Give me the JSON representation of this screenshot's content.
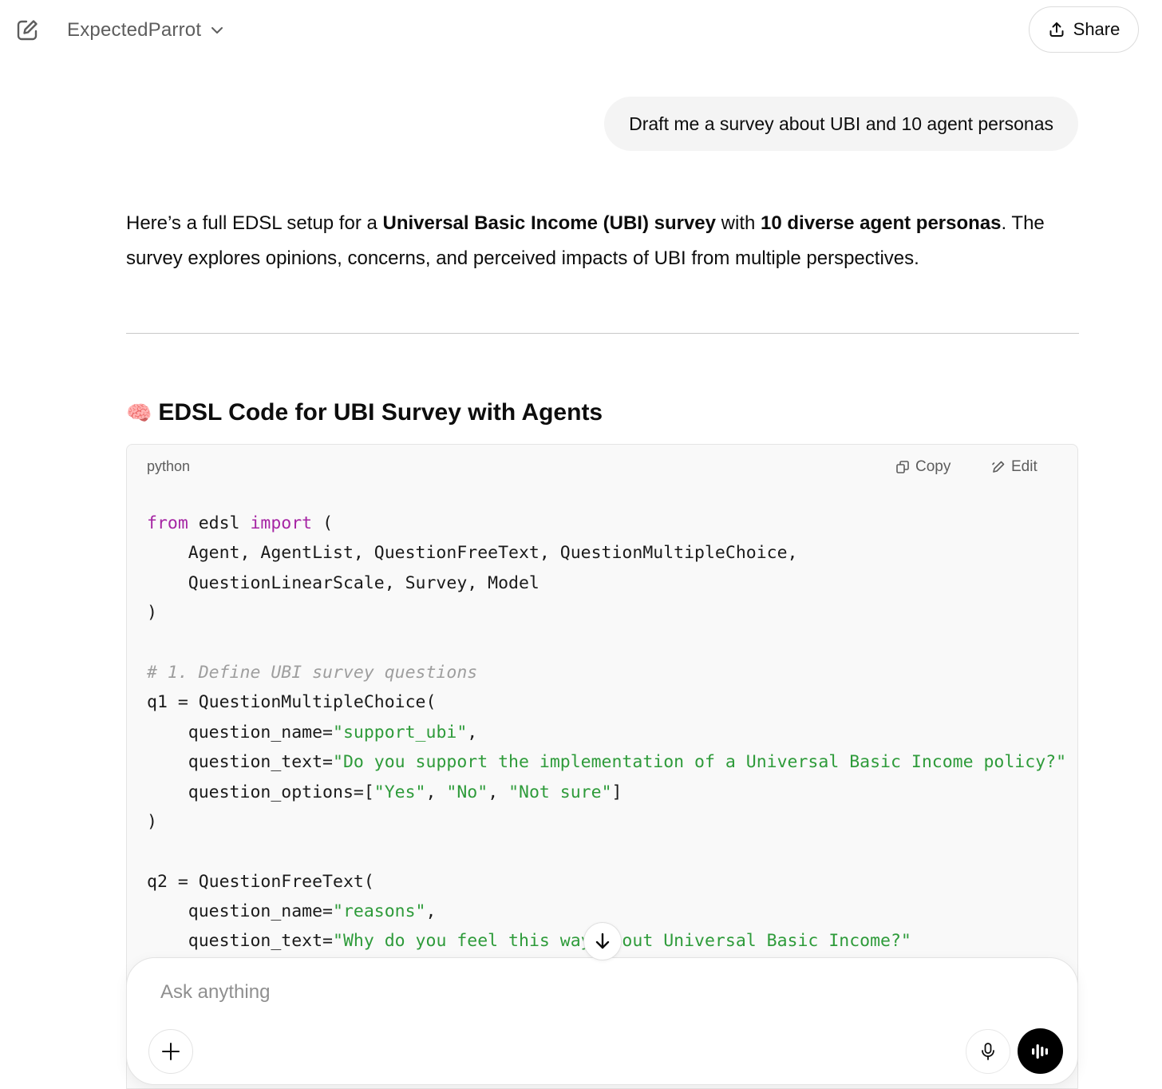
{
  "header": {
    "workspace_name": "ExpectedParrot",
    "share_label": "Share",
    "icons": {
      "new_chat": "edit-square-icon",
      "picker": "chevron-down-icon",
      "share": "upload-icon"
    }
  },
  "conversation": {
    "user_message": "Draft me a survey about UBI and 10 agent personas",
    "assistant": {
      "intro": {
        "t1": "Here’s a full EDSL setup for a ",
        "b1": "Universal Basic Income (UBI) survey",
        "t2": " with ",
        "b2": "10 diverse agent personas",
        "t3": ". The survey explores opinions, concerns, and perceived impacts of UBI from multiple perspectives."
      },
      "section_emoji": "🧠",
      "section_title": "EDSL Code for UBI Survey with Agents",
      "code_block": {
        "language": "python",
        "copy_label": "Copy",
        "edit_label": "Edit",
        "lines": [
          [
            {
              "t": "kw",
              "v": "from"
            },
            {
              "t": "",
              "v": " edsl "
            },
            {
              "t": "kw",
              "v": "import"
            },
            {
              "t": "",
              "v": " ("
            }
          ],
          [
            {
              "t": "",
              "v": "    Agent, AgentList, QuestionFreeText, QuestionMultipleChoice,"
            }
          ],
          [
            {
              "t": "",
              "v": "    QuestionLinearScale, Survey, Model"
            }
          ],
          [
            {
              "t": "",
              "v": ")"
            }
          ],
          [
            {
              "t": "",
              "v": ""
            }
          ],
          [
            {
              "t": "com",
              "v": "# 1. Define UBI survey questions"
            }
          ],
          [
            {
              "t": "",
              "v": "q1 = QuestionMultipleChoice("
            }
          ],
          [
            {
              "t": "",
              "v": "    question_name="
            },
            {
              "t": "str",
              "v": "\"support_ubi\""
            },
            {
              "t": "",
              "v": ","
            }
          ],
          [
            {
              "t": "",
              "v": "    question_text="
            },
            {
              "t": "str",
              "v": "\"Do you support the implementation of a Universal Basic Income policy?\""
            }
          ],
          [
            {
              "t": "",
              "v": "    question_options=["
            },
            {
              "t": "str",
              "v": "\"Yes\""
            },
            {
              "t": "",
              "v": ", "
            },
            {
              "t": "str",
              "v": "\"No\""
            },
            {
              "t": "",
              "v": ", "
            },
            {
              "t": "str",
              "v": "\"Not sure\""
            },
            {
              "t": "",
              "v": "]"
            }
          ],
          [
            {
              "t": "",
              "v": ")"
            }
          ],
          [
            {
              "t": "",
              "v": ""
            }
          ],
          [
            {
              "t": "",
              "v": "q2 = QuestionFreeText("
            }
          ],
          [
            {
              "t": "",
              "v": "    question_name="
            },
            {
              "t": "str",
              "v": "\"reasons\""
            },
            {
              "t": "",
              "v": ","
            }
          ],
          [
            {
              "t": "",
              "v": "    question_text="
            },
            {
              "t": "str",
              "v": "\"Why do you feel this way about Universal Basic Income?\""
            }
          ]
        ]
      }
    }
  },
  "composer": {
    "placeholder": "Ask anything",
    "icons": {
      "add": "plus-icon",
      "mic": "microphone-icon",
      "voice": "voice-waveform-icon",
      "scroll": "arrow-down-icon"
    }
  },
  "colors": {
    "keyword": "#a626a4",
    "string": "#2e9b3a",
    "comment": "#9e9e9e",
    "bubble_bg": "#f4f4f4",
    "code_bg": "#f9f9f9"
  }
}
